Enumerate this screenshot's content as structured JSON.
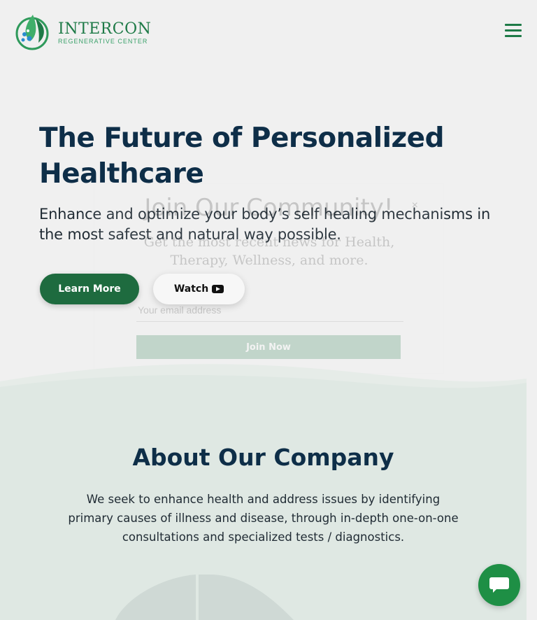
{
  "header": {
    "logo_name": "INTERCON",
    "logo_sub": "REGENERATIVE CENTER",
    "menu_icon": "hamburger-menu-icon"
  },
  "hero": {
    "title": "The Future of Personalized Healthcare",
    "subtitle": "Enhance and optimize your body’s self healing mechanisms in the most safest and natural way possible.",
    "learn_more_label": "Learn More",
    "watch_label": "Watch",
    "watch_icon": "youtube-play-icon"
  },
  "popup": {
    "title": "Join Our Community!",
    "description": "Get the most recent news for Health, Therapy, Wellness, and more.",
    "email_placeholder": "Your email address",
    "submit_label": "Join Now",
    "close_label": "×"
  },
  "about": {
    "title": "About Our Company",
    "text": "We seek to enhance health and address issues by identifying primary causes of illness and disease, through in-depth one-on-one consultations and specialized tests / diagnostics."
  },
  "chat": {
    "icon": "chat-bubble-icon"
  },
  "colors": {
    "brand_green": "#1e7a47",
    "dark_navy": "#0e2e48",
    "section_bg": "#dfe8e3"
  }
}
